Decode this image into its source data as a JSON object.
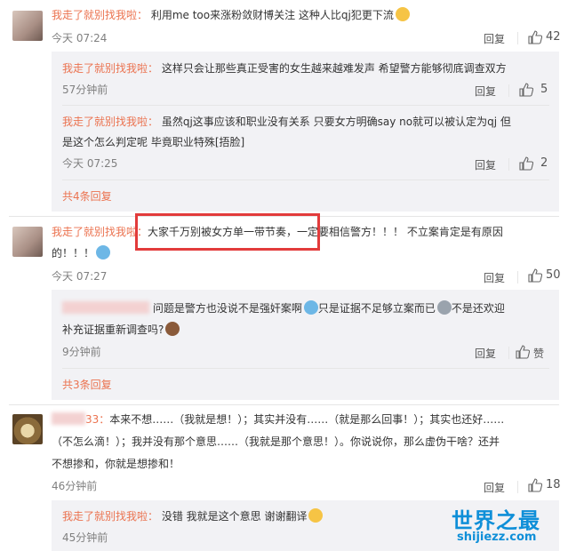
{
  "c1": {
    "user": "我走了就别找我啦：",
    "text": "利用me too来涨粉敛财博关注 这种人比qj犯更下流",
    "time": "今天 07:24",
    "reply": "回复",
    "likes": "42"
  },
  "c1r1": {
    "user": "我走了就别找我啦：",
    "text": "这样只会让那些真正受害的女生越来越难发声 希望警方能够彻底调查双方",
    "time": "57分钟前",
    "reply": "回复",
    "likes": "5"
  },
  "c1r2": {
    "user": "我走了就别找我啦：",
    "text1": "虽然qj这事应该和职业没有关系 只要女方明确say no就可以被认定为qj 但",
    "text2": "是这个怎么判定呢 毕竟职业特殊[捂脸]",
    "time": "今天 07:25",
    "reply": "回复",
    "likes": "2"
  },
  "c1_more": "共4条回复",
  "c2": {
    "user": "我走了就别找我啦：",
    "text1": "大家千万别被女方单一带节奏，一定要相信警方！！！ 不立案肯定是有原因",
    "text2": "的！！！",
    "time": "今天 07:27",
    "reply": "回复",
    "likes": "50"
  },
  "c2r1": {
    "text1": "问题是警方也没说不是强奸案啊",
    "text1b": "只是证据不足够立案而已",
    "text1c": "不是还欢迎",
    "text2": "补充证据重新调查吗?",
    "time": "9分钟前",
    "reply": "回复",
    "likes": "赞"
  },
  "c2_more": "共3条回复",
  "c3": {
    "user_tail": "33：",
    "text1": "本来不想……（我就是想！）；其实并没有……（就是那么回事！）；其实也还好……",
    "text2": "（不怎么滴！）；我并没有那个意思……（我就是那个意思！）。你说说你，那么虚伪干啥？还并",
    "text3": "不想掺和，你就是想掺和！",
    "time": "46分钟前",
    "reply": "回复",
    "likes": "18"
  },
  "c3r1": {
    "user": "我走了就别找我啦：",
    "text": "没错 我就是这个意思 谢谢翻译",
    "time": "45分钟前"
  },
  "watermark": {
    "title": "世界之最",
    "url": "shijiezz.com"
  }
}
